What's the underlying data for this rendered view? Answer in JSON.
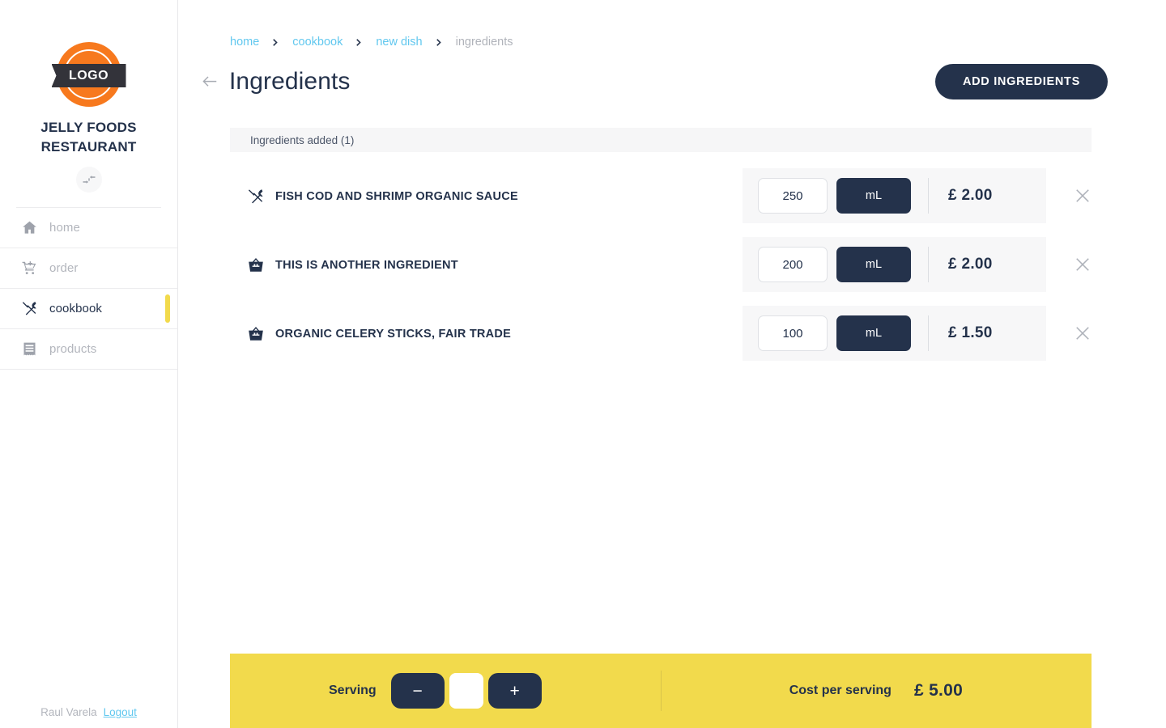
{
  "sidebar": {
    "logo_text": "LOGO",
    "brand_name": "JELLY FOODS RESTAURANT",
    "collapse_icon": "collapse-arrows-icon",
    "items": [
      {
        "label": "home",
        "icon": "home-icon",
        "active": false
      },
      {
        "label": "order",
        "icon": "cart-add-icon",
        "active": false
      },
      {
        "label": "cookbook",
        "icon": "cutlery-icon",
        "active": true
      },
      {
        "label": "products",
        "icon": "receipt-icon",
        "active": false
      }
    ],
    "footer": {
      "user_name": "Raul Varela",
      "logout_label": "Logout"
    }
  },
  "header": {
    "breadcrumb": [
      {
        "label": "home",
        "current": false
      },
      {
        "label": "cookbook",
        "current": false
      },
      {
        "label": "new dish",
        "current": false
      },
      {
        "label": "ingredients",
        "current": true
      }
    ],
    "back_icon": "arrow-left-icon",
    "title": "Ingredients",
    "add_button_label": "ADD INGREDIENTS"
  },
  "list": {
    "header_label": "Ingredients added (1)",
    "rows": [
      {
        "name": "FISH COD AND SHRIMP ORGANIC SAUCE",
        "icon": "cutlery-icon",
        "quantity": "250",
        "unit": "mL",
        "price": "£ 2.00",
        "remove_icon": "close-icon"
      },
      {
        "name": "THIS IS ANOTHER INGREDIENT",
        "icon": "basket-icon",
        "quantity": "200",
        "unit": "mL",
        "price": "£ 2.00",
        "remove_icon": "close-icon"
      },
      {
        "name": "ORGANIC CELERY STICKS, FAIR TRADE",
        "icon": "basket-icon",
        "quantity": "100",
        "unit": "mL",
        "price": "£ 1.50",
        "remove_icon": "close-icon"
      }
    ]
  },
  "bottom_bar": {
    "serving_label": "Serving",
    "decrement_label": "−",
    "increment_label": "+",
    "serving_value": "",
    "cost_label": "Cost per serving",
    "cost_value": "£ 5.00"
  },
  "colors": {
    "navy": "#24324b",
    "yellow": "#f2da4c",
    "link_blue": "#62c8ef",
    "muted": "#b3b6bd",
    "row_bg": "#f7f7f8",
    "logo_orange": "#f7791e"
  }
}
